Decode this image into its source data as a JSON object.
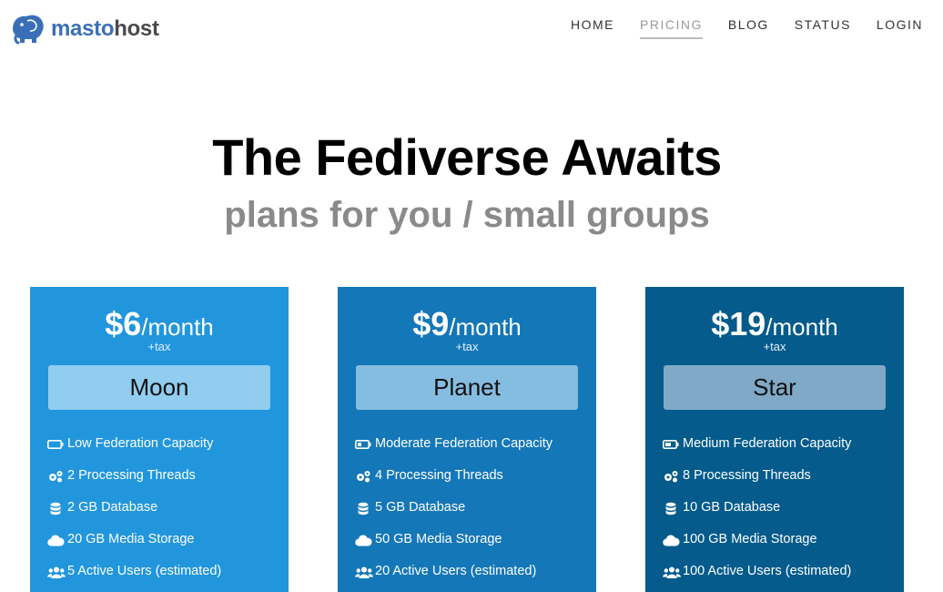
{
  "brand": {
    "prefix": "masto",
    "suffix": "host"
  },
  "nav": [
    {
      "label": "HOME",
      "active": false
    },
    {
      "label": "PRICING",
      "active": true
    },
    {
      "label": "BLOG",
      "active": false
    },
    {
      "label": "STATUS",
      "active": false
    },
    {
      "label": "LOGIN",
      "active": false
    }
  ],
  "hero": {
    "title": "The Fediverse Awaits",
    "subtitle": "plans for you / small groups"
  },
  "plans": [
    {
      "price": "$6",
      "period": "/month",
      "tax": "+tax",
      "name": "Moon",
      "features": [
        {
          "icon": "battery-low-icon",
          "text": "Low Federation Capacity"
        },
        {
          "icon": "cogs-icon",
          "text": "2 Processing Threads"
        },
        {
          "icon": "database-icon",
          "text": "2 GB Database"
        },
        {
          "icon": "cloud-icon",
          "text": "20 GB Media Storage"
        },
        {
          "icon": "users-icon",
          "text": "5 Active Users (estimated)"
        }
      ]
    },
    {
      "price": "$9",
      "period": "/month",
      "tax": "+tax",
      "name": "Planet",
      "features": [
        {
          "icon": "battery-quarter-icon",
          "text": "Moderate Federation Capacity"
        },
        {
          "icon": "cogs-icon",
          "text": "4 Processing Threads"
        },
        {
          "icon": "database-icon",
          "text": "5 GB Database"
        },
        {
          "icon": "cloud-icon",
          "text": "50 GB Media Storage"
        },
        {
          "icon": "users-icon",
          "text": "20 Active Users (estimated)"
        }
      ]
    },
    {
      "price": "$19",
      "period": "/month",
      "tax": "+tax",
      "name": "Star",
      "features": [
        {
          "icon": "battery-half-icon",
          "text": "Medium Federation Capacity"
        },
        {
          "icon": "cogs-icon",
          "text": "8 Processing Threads"
        },
        {
          "icon": "database-icon",
          "text": "10 GB Database"
        },
        {
          "icon": "cloud-icon",
          "text": "100 GB Media Storage"
        },
        {
          "icon": "users-icon",
          "text": "100 Active Users (estimated)"
        }
      ]
    }
  ],
  "colors": {
    "moon": "#2196dd",
    "planet": "#1477b8",
    "star": "#045b8c",
    "brand_blue": "#3a6fb7"
  }
}
